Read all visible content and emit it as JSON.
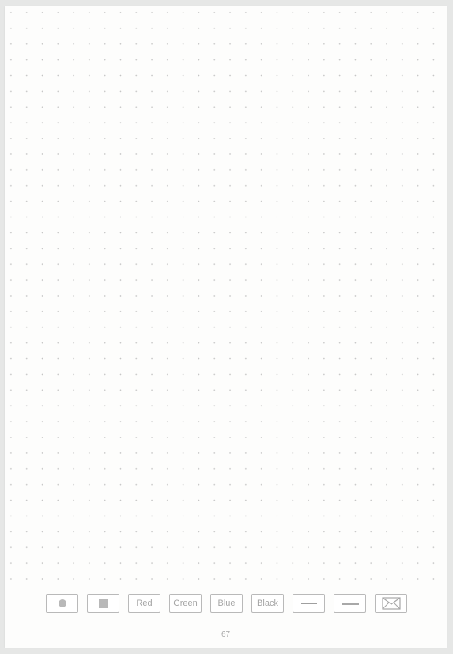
{
  "toolbar": {
    "buttons": [
      {
        "name": "dot-tool-button",
        "icon": "dot-icon"
      },
      {
        "name": "square-tool-button",
        "icon": "square-icon"
      },
      {
        "name": "red-color-button",
        "label": "Red"
      },
      {
        "name": "green-color-button",
        "label": "Green"
      },
      {
        "name": "blue-color-button",
        "label": "Blue"
      },
      {
        "name": "black-color-button",
        "label": "Black"
      },
      {
        "name": "thin-line-button",
        "icon": "thin-line-icon"
      },
      {
        "name": "thick-line-button",
        "icon": "thick-line-icon"
      },
      {
        "name": "mail-button",
        "icon": "envelope-icon"
      }
    ]
  },
  "page": {
    "number": "67"
  },
  "colors": {
    "background": "#e6e7e6",
    "paper": "#fdfdfc",
    "dot": "#c3c3c3",
    "button_border": "#b9b9b9",
    "button_text": "#a5a5a5"
  }
}
